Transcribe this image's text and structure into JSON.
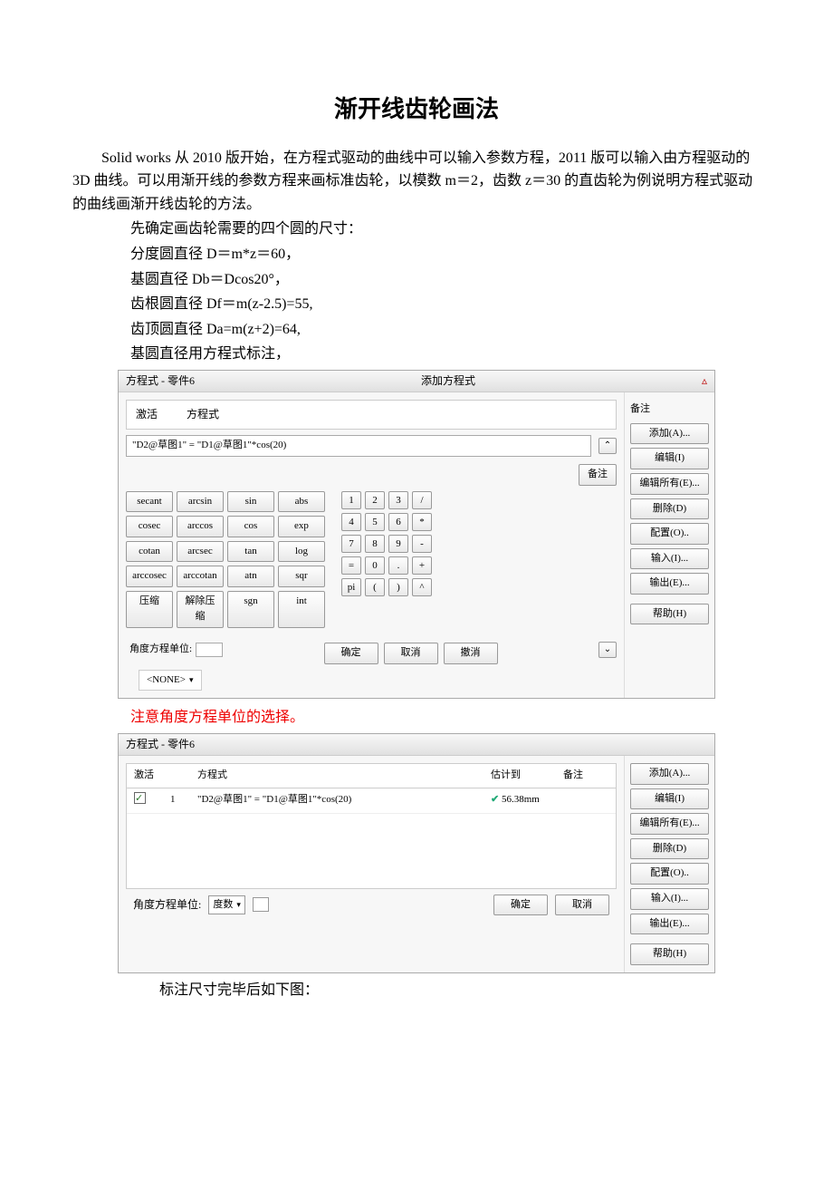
{
  "title": "渐开线齿轮画法",
  "paragraph": "Solid works 从 2010 版开始，在方程式驱动的曲线中可以输入参数方程，2011 版可以输入由方程驱动的 3D 曲线。可以用渐开线的参数方程来画标准齿轮，以模数 m＝2，齿数 z＝30 的直齿轮为例说明方程式驱动的曲线画渐开线齿轮的方法。",
  "lines": [
    "先确定画齿轮需要的四个圆的尺寸：",
    "分度圆直径 D＝m*z＝60，",
    "基圆直径 Db＝Dcos20°，",
    "齿根圆直径 Df＝m(z-2.5)=55,",
    "齿顶圆直径 Da=m(z+2)=64,",
    "基圆直径用方程式标注，"
  ],
  "dialog1": {
    "window_title_left": "方程式 - 零件6",
    "window_title_right": "添加方程式",
    "close": "▵",
    "header_activate": "激活",
    "header_eq": "方程式",
    "equation": "\"D2@草图1\" = \"D1@草图1\"*cos(20)",
    "note_btn": "备注",
    "note_label": "备注",
    "fns": [
      "secant",
      "arcsin",
      "sin",
      "abs",
      "cosec",
      "arccos",
      "cos",
      "exp",
      "cotan",
      "arcsec",
      "tan",
      "log",
      "arccosec",
      "arccotan",
      "atn",
      "sqr",
      "压缩",
      "解除压缩",
      "sgn",
      "int"
    ],
    "nums": [
      [
        "1",
        "2",
        "3",
        "/"
      ],
      [
        "4",
        "5",
        "6",
        "*"
      ],
      [
        "7",
        "8",
        "9",
        "-"
      ],
      [
        "=",
        "0",
        ".",
        "+"
      ],
      [
        "pi",
        "(",
        ")",
        "^"
      ]
    ],
    "bottom": [
      "确定",
      "取消",
      "撤消"
    ],
    "angle_label": "角度方程单位:",
    "right_btns": [
      "添加(A)...",
      "编辑(I)",
      "编辑所有(E)...",
      "删除(D)",
      "配置(O)..",
      "输入(I)...",
      "输出(E)...",
      "帮助(H)"
    ],
    "none": "<NONE>"
  },
  "note_red": "注意角度方程单位的选择。",
  "dialog2": {
    "window_title": "方程式 - 零件6",
    "cols": {
      "active": "激活",
      "eq": "方程式",
      "val": "估计到",
      "note": "备注"
    },
    "row": {
      "idx": "1",
      "eq": "\"D2@草图1\" = \"D1@草图1\"*cos(20)",
      "val": "56.38mm"
    },
    "right_btns": [
      "添加(A)...",
      "编辑(I)",
      "编辑所有(E)...",
      "删除(D)",
      "配置(O)..",
      "输入(I)...",
      "输出(E)...",
      "帮助(H)"
    ],
    "angle_label": "角度方程单位:",
    "angle_unit": "度数",
    "ok": "确定",
    "cancel": "取消"
  },
  "after_text": "标注尺寸完毕后如下图："
}
